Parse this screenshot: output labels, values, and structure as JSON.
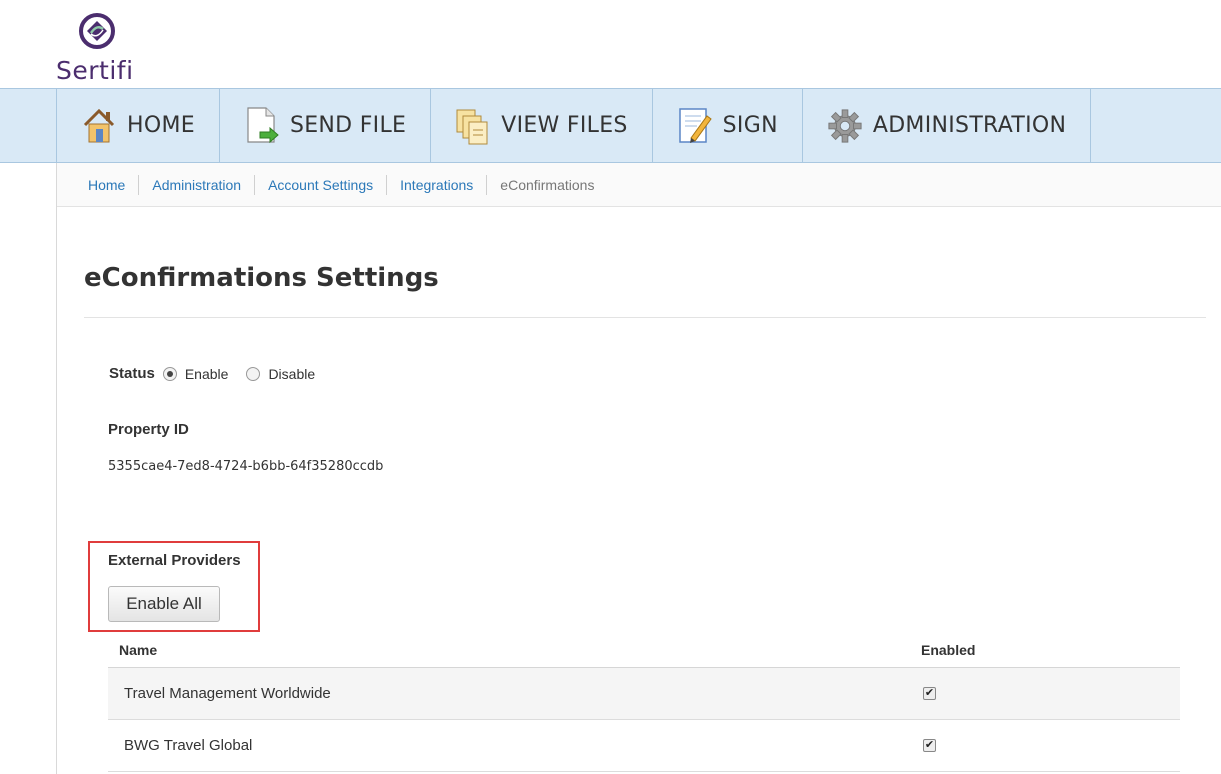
{
  "app": {
    "logo_text": "Sertifi"
  },
  "nav": {
    "items": [
      {
        "label": "HOME",
        "icon": "house-icon"
      },
      {
        "label": "SEND FILE",
        "icon": "send-file-icon"
      },
      {
        "label": "VIEW FILES",
        "icon": "view-files-icon"
      },
      {
        "label": "SIGN",
        "icon": "sign-icon"
      },
      {
        "label": "ADMINISTRATION",
        "icon": "gear-icon"
      }
    ]
  },
  "breadcrumb": [
    "Home",
    "Administration",
    "Account Settings",
    "Integrations",
    "eConfirmations"
  ],
  "page": {
    "title": "eConfirmations Settings",
    "status_label": "Status",
    "status_options": [
      {
        "label": "Enable",
        "selected": true
      },
      {
        "label": "Disable",
        "selected": false
      }
    ],
    "property_id_label": "Property ID",
    "property_id_value": "5355cae4-7ed8-4724-b6bb-64f35280ccdb",
    "external_providers_label": "External Providers",
    "enable_all_label": "Enable All"
  },
  "providers_table": {
    "columns": [
      "Name",
      "Enabled"
    ],
    "rows": [
      {
        "name": "Travel Management Worldwide",
        "enabled": true
      },
      {
        "name": "BWG Travel Global",
        "enabled": true
      }
    ]
  },
  "colors": {
    "nav_background": "#d9e9f6",
    "link": "#2b78b8",
    "logo": "#4b2d6e",
    "highlight": "#e03c3c"
  }
}
